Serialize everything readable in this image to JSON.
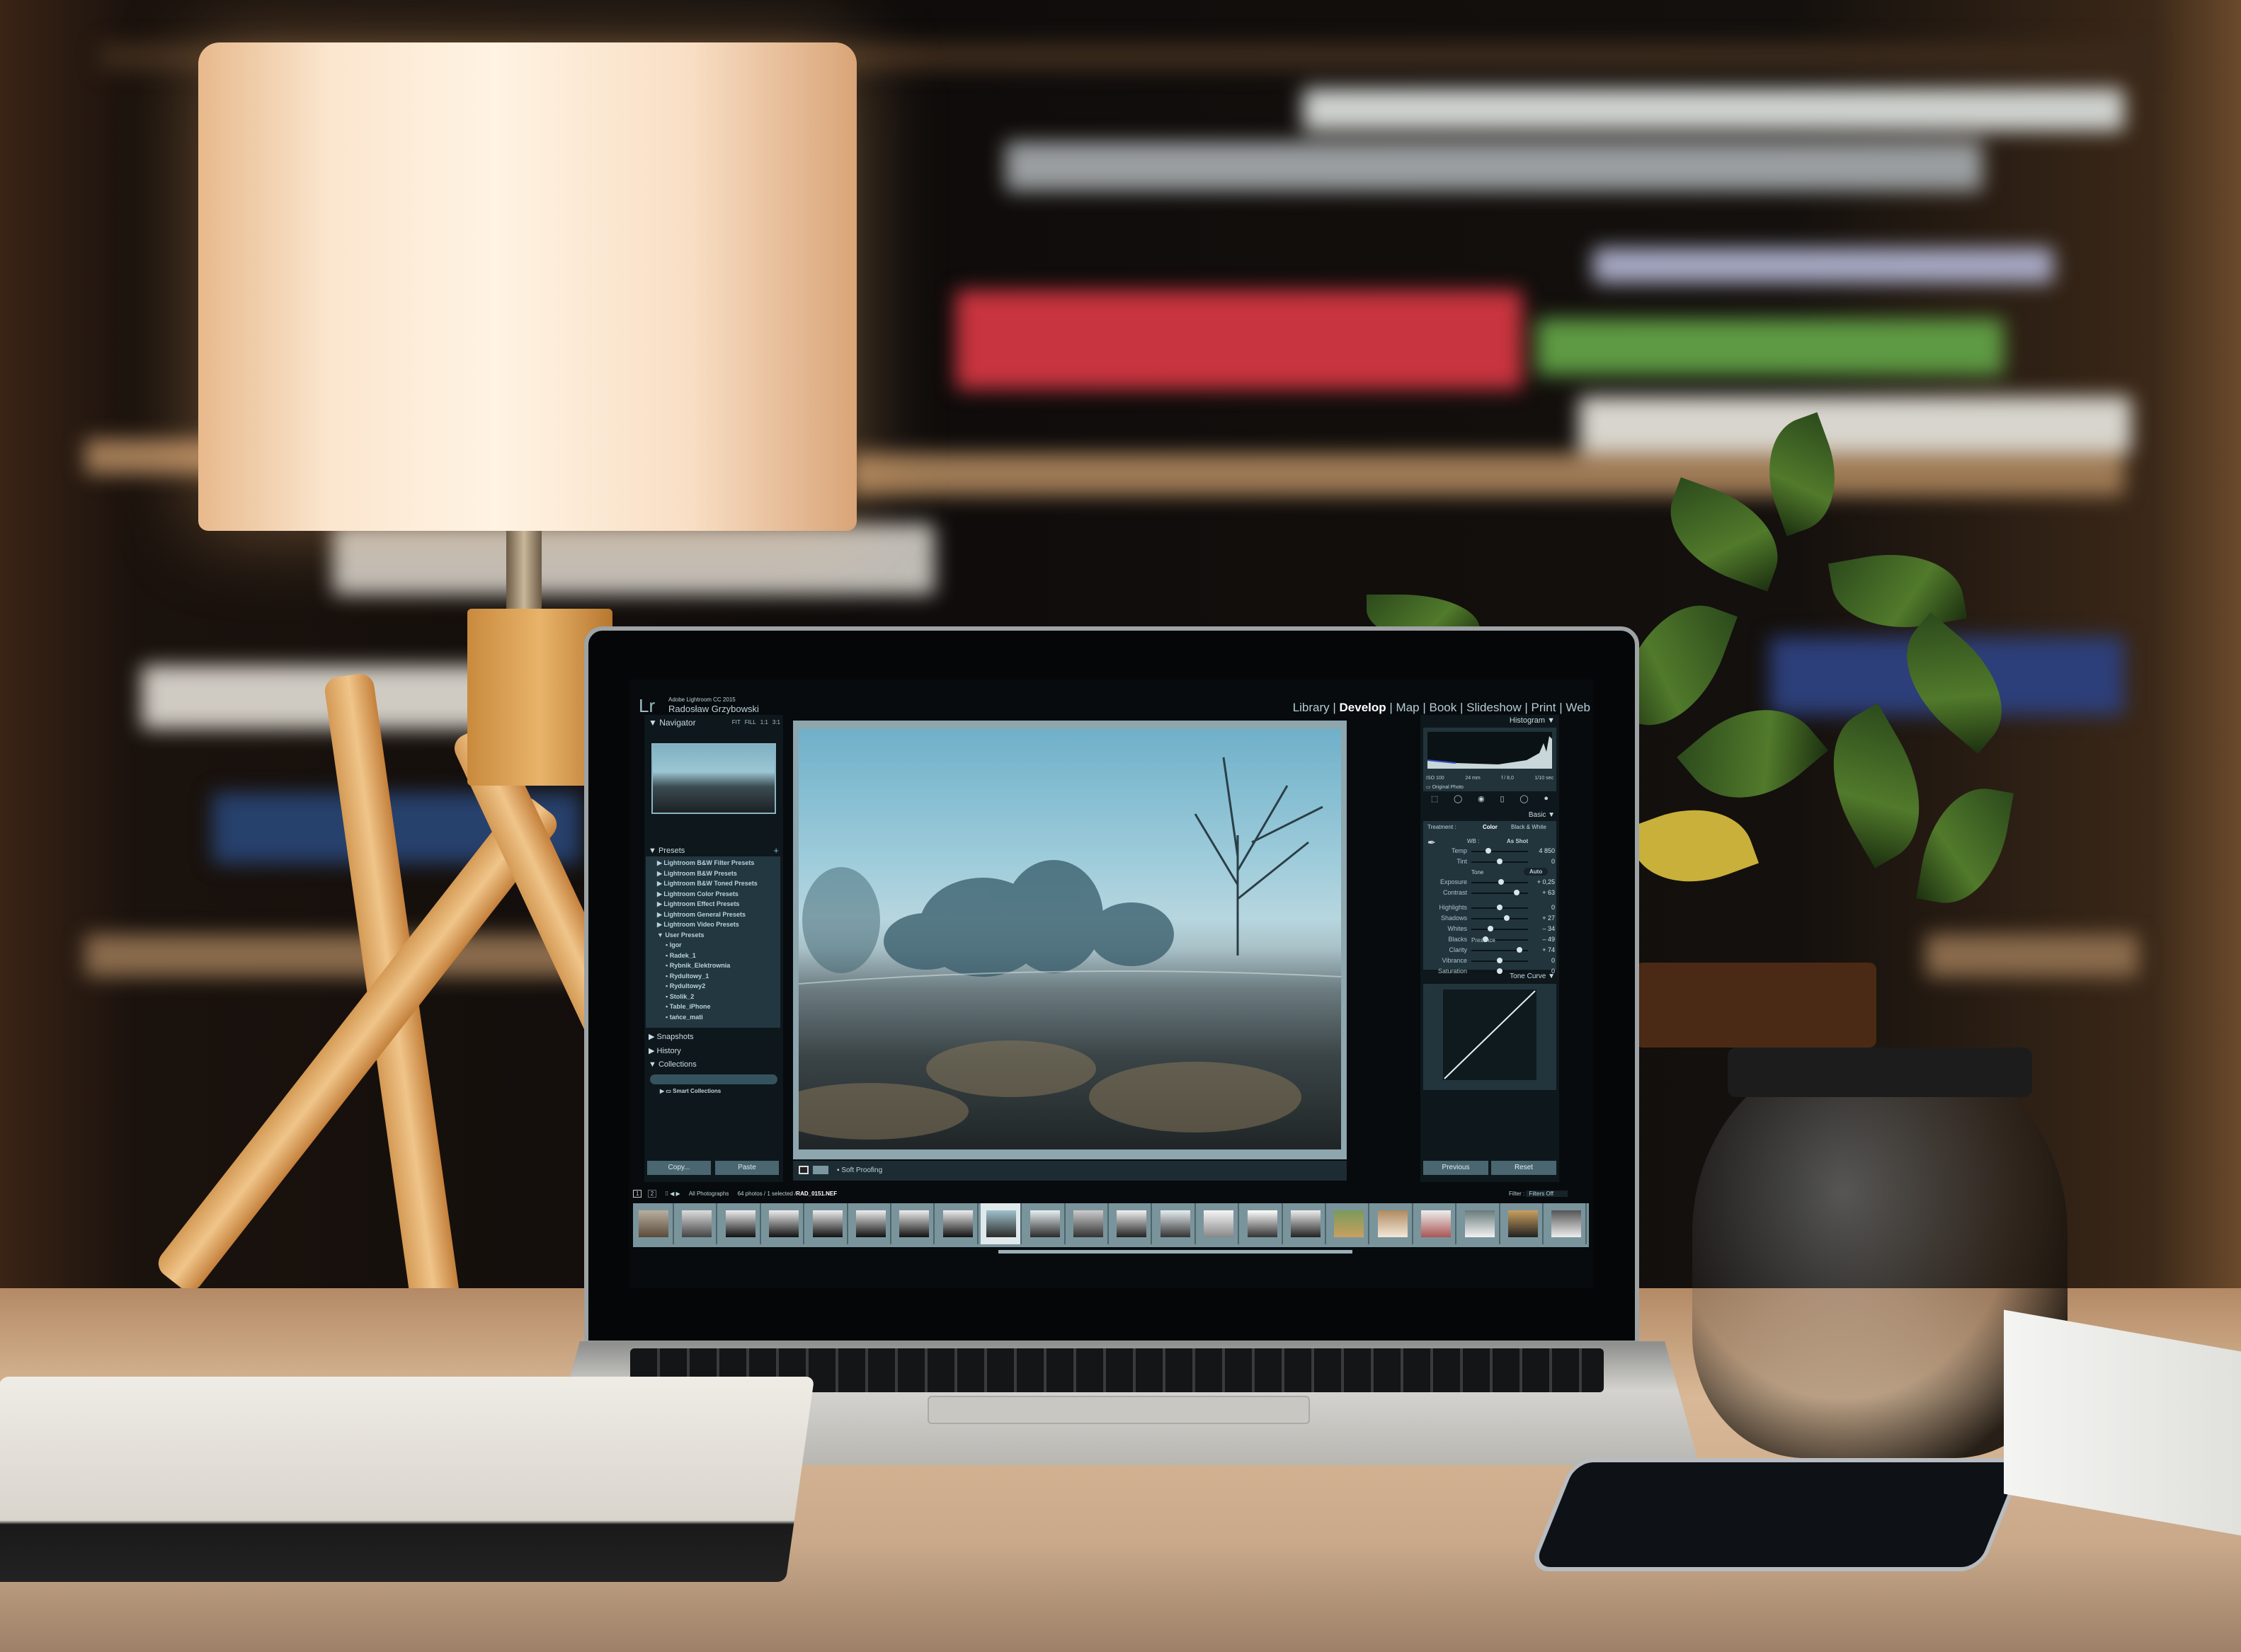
{
  "app": {
    "logo": "Lr",
    "product": "Adobe Lightroom CC 2015",
    "user": "Radosław Grzybowski",
    "modules": [
      "Library",
      "Develop",
      "Map",
      "Book",
      "Slideshow",
      "Print",
      "Web"
    ],
    "active_module": "Develop"
  },
  "left_panel": {
    "navigator": {
      "title": "Navigator",
      "zoom_options": [
        "FIT",
        "FILL",
        "1:1",
        "3:1"
      ]
    },
    "presets": {
      "title": "Presets",
      "folders": [
        "Lightroom B&W Filter Presets",
        "Lightroom B&W Presets",
        "Lightroom B&W Toned Presets",
        "Lightroom Color Presets",
        "Lightroom Effect Presets",
        "Lightroom General Presets",
        "Lightroom Video Presets"
      ],
      "user_folder": "User Presets",
      "user_presets": [
        "Igor",
        "Radek_1",
        "Rybnik_Elektrownia",
        "Rydultowy_1",
        "Rydultowy2",
        "Stolik_2",
        "Table_iPhone",
        "tańce_mati"
      ]
    },
    "snapshots": "Snapshots",
    "history": "History",
    "collections": {
      "title": "Collections",
      "items": [
        "Smart Collections"
      ]
    },
    "copy_label": "Copy...",
    "paste_label": "Paste"
  },
  "toolbar": {
    "soft_proofing": "Soft Proofing"
  },
  "right_panel": {
    "histogram": {
      "title": "Histogram",
      "iso": "ISO 100",
      "focal": "24 mm",
      "aperture": "f / 8,0",
      "shutter": "1/10 sec",
      "original_photo": "Original Photo"
    },
    "basic": {
      "title": "Basic",
      "treatment_label": "Treatment :",
      "treatment_options": [
        "Color",
        "Black & White"
      ],
      "treatment_selected": "Color",
      "wb_label": "WB :",
      "wb_value": "As Shot",
      "wb_sliders": [
        {
          "label": "Temp",
          "value": "4 850",
          "position": 0.3
        },
        {
          "label": "Tint",
          "value": "0",
          "position": 0.5
        }
      ],
      "tone_label": "Tone",
      "auto_label": "Auto",
      "tone_sliders": [
        {
          "label": "Exposure",
          "value": "+ 0,25",
          "position": 0.52
        },
        {
          "label": "Contrast",
          "value": "+ 63",
          "position": 0.8
        },
        {
          "label": "Highlights",
          "value": "0",
          "position": 0.5
        },
        {
          "label": "Shadows",
          "value": "+ 27",
          "position": 0.62
        },
        {
          "label": "Whites",
          "value": "– 34",
          "position": 0.34
        },
        {
          "label": "Blacks",
          "value": "– 49",
          "position": 0.25
        }
      ],
      "presence_label": "Presence",
      "presence_sliders": [
        {
          "label": "Clarity",
          "value": "+ 74",
          "position": 0.85
        },
        {
          "label": "Vibrance",
          "value": "0",
          "position": 0.5
        },
        {
          "label": "Saturation",
          "value": "0",
          "position": 0.5
        }
      ]
    },
    "tone_curve": {
      "title": "Tone Curve"
    },
    "previous_label": "Previous",
    "reset_label": "Reset"
  },
  "filmstrip": {
    "pages": [
      "1",
      "2"
    ],
    "source": "All Photographs",
    "count_text": "64 photos / 1 selected /",
    "filename": "RAD_0151.NEF",
    "filter_label": "Filter :",
    "filter_value": "Filters Off",
    "selected_index": 8
  },
  "colors": {
    "panel": "#1b2a31",
    "screen_bg": "#070b0e",
    "accent_text": "#c8dde4",
    "photo_sky": "#8fc3d6"
  }
}
